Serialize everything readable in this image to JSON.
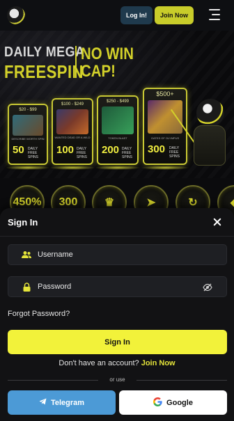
{
  "header": {
    "login_label": "Log In!",
    "join_label": "Join Now"
  },
  "banner": {
    "line1": "DAILY MEGA",
    "line2": "FREESPIN",
    "line3": "NO WIN",
    "line4": "CAP!",
    "cards": [
      {
        "price": "$20 - $99",
        "caption": "DESCRIBE WORTH SPIN",
        "count": "50",
        "label": "DAILY FREE SPINS"
      },
      {
        "price": "$100 - $249",
        "caption": "WANTED DEAD OR A WILD",
        "count": "100",
        "label": "DAILY FREE SPINS"
      },
      {
        "price": "$250 - $499",
        "caption": "TOKEN BLAST",
        "count": "200",
        "label": "DAILY FREE SPINS"
      },
      {
        "price": "$500+",
        "caption": "GATES OF OLYMPUS",
        "count": "300",
        "label": "DAILY FREE SPINS"
      }
    ]
  },
  "badges": [
    "450%",
    "300",
    "",
    "",
    "",
    ""
  ],
  "signin": {
    "title": "Sign In",
    "username_placeholder": "Username",
    "password_placeholder": "Password",
    "forgot_label": "Forgot Password?",
    "submit_label": "Sign In",
    "no_account_text": "Don't have an account?",
    "join_link": "Join Now",
    "or_use": "or use",
    "telegram_label": "Telegram",
    "google_label": "Google"
  }
}
